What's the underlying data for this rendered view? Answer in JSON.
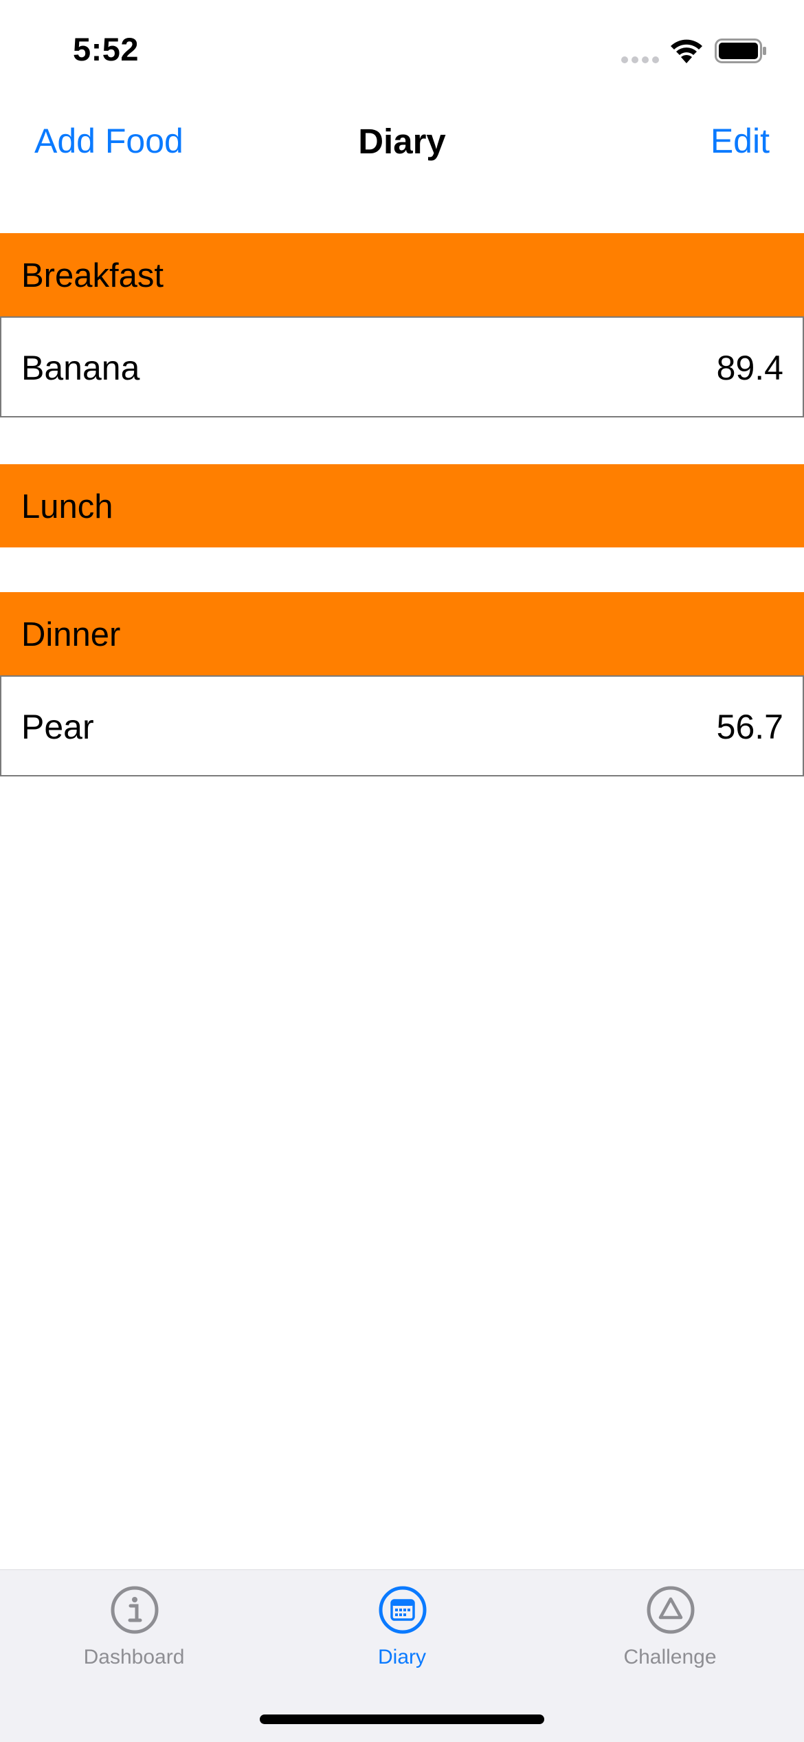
{
  "status": {
    "time": "5:52"
  },
  "nav": {
    "left_label": "Add Food",
    "title": "Diary",
    "right_label": "Edit"
  },
  "sections": [
    {
      "title": "Breakfast",
      "items": [
        {
          "name": "Banana",
          "value": "89.4"
        }
      ]
    },
    {
      "title": "Lunch",
      "items": []
    },
    {
      "title": "Dinner",
      "items": [
        {
          "name": "Pear",
          "value": "56.7"
        }
      ]
    }
  ],
  "tabs": [
    {
      "label": "Dashboard",
      "icon": "info-icon",
      "active": false
    },
    {
      "label": "Diary",
      "icon": "calendar-icon",
      "active": true
    },
    {
      "label": "Challenge",
      "icon": "triangle-icon",
      "active": false
    }
  ],
  "colors": {
    "accent": "#0a7aff",
    "section_header": "#ff7f00",
    "tab_inactive": "#8e8e93",
    "tab_bar_bg": "#f1f1f5"
  }
}
